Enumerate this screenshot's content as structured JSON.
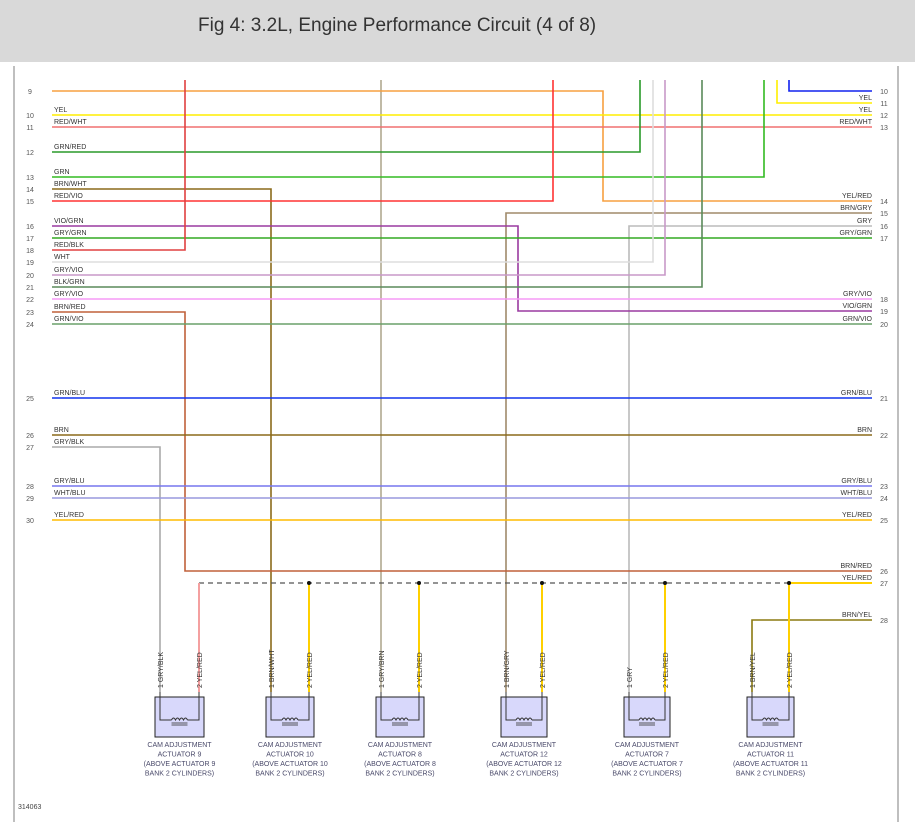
{
  "header": {
    "title": "Fig 4: 3.2L, Engine Performance Circuit (4 of 8)"
  },
  "figure_id": "314063",
  "left_rows": [
    {
      "num": "9",
      "label": "",
      "color": "#f7a040"
    },
    {
      "num": "10",
      "label": "YEL",
      "color": "#ffee00"
    },
    {
      "num": "11",
      "label": "RED/WHT",
      "color": "#f07070"
    },
    {
      "num": "12",
      "label": "GRN/RED",
      "color": "#2a9a2a"
    },
    {
      "num": "13",
      "label": "GRN",
      "color": "#33bb22"
    },
    {
      "num": "14",
      "label": "BRN/WHT",
      "color": "#8b6a1a"
    },
    {
      "num": "15",
      "label": "RED/VIO",
      "color": "#ff3333"
    },
    {
      "num": "16",
      "label": "VIO/GRN",
      "color": "#9a3aa0"
    },
    {
      "num": "17",
      "label": "GRY/GRN",
      "color": "#33aa22"
    },
    {
      "num": "18",
      "label": "RED/BLK",
      "color": "#e04040"
    },
    {
      "num": "19",
      "label": "WHT",
      "color": "#dddddd"
    },
    {
      "num": "20",
      "label": "GRY/VIO",
      "color": "#c899c8"
    },
    {
      "num": "21",
      "label": "BLK/GRN",
      "color": "#5a8a5a"
    },
    {
      "num": "22",
      "label": "GRY/VIO",
      "color": "#f59af5"
    },
    {
      "num": "23",
      "label": "BRN/RED",
      "color": "#c0603a"
    },
    {
      "num": "24",
      "label": "GRN/VIO",
      "color": "#6aa06a"
    },
    {
      "num": "25",
      "label": "GRN/BLU",
      "color": "#1133ee"
    },
    {
      "num": "26",
      "label": "BRN",
      "color": "#8b6a1a"
    },
    {
      "num": "27",
      "label": "GRY/BLK",
      "color": "#aaaaaa"
    },
    {
      "num": "28",
      "label": "GRY/BLU",
      "color": "#7777ee"
    },
    {
      "num": "29",
      "label": "WHT/BLU",
      "color": "#9999dd"
    },
    {
      "num": "30",
      "label": "YEL/RED",
      "color": "#ffbb00"
    }
  ],
  "right_rows": [
    {
      "num": "10",
      "label": ""
    },
    {
      "num": "11",
      "label": "YEL"
    },
    {
      "num": "12",
      "label": "YEL"
    },
    {
      "num": "13",
      "label": "RED/WHT"
    },
    {
      "num": "14",
      "label": "YEL/RED"
    },
    {
      "num": "15",
      "label": "BRN/GRY"
    },
    {
      "num": "16",
      "label": "GRY"
    },
    {
      "num": "17",
      "label": "GRY/GRN"
    },
    {
      "num": "18",
      "label": "GRY/VIO"
    },
    {
      "num": "19",
      "label": "VIO/GRN"
    },
    {
      "num": "20",
      "label": "GRN/VIO"
    },
    {
      "num": "21",
      "label": "GRN/BLU"
    },
    {
      "num": "22",
      "label": "BRN"
    },
    {
      "num": "23",
      "label": "GRY/BLU"
    },
    {
      "num": "24",
      "label": "WHT/BLU"
    },
    {
      "num": "25",
      "label": "YEL/RED"
    },
    {
      "num": "26",
      "label": "BRN/RED"
    },
    {
      "num": "27",
      "label": "YEL/RED"
    },
    {
      "num": "28",
      "label": "BRN/YEL"
    }
  ],
  "right_wire_colors": {
    "blu": "#1122ee",
    "yel": "#ffee00",
    "brn_gry": "#a08a6a",
    "gry": "#bbbbbb",
    "yel_red": "#ffd000",
    "brn_yel": "#8b7a10",
    "gry_brn": "#b0a890",
    "brn_red": "#c07a3a"
  },
  "actuators": [
    {
      "lines": [
        "CAM ADJUSTMENT",
        "ACTUATOR 9",
        "(ABOVE ACTUATOR 9",
        "BANK 2 CYLINDERS)"
      ],
      "pin1": "1  GRY/BLK",
      "pin2": "2  YEL/RED"
    },
    {
      "lines": [
        "CAM ADJUSTMENT",
        "ACTUATOR 10",
        "(ABOVE ACTUATOR 10",
        "BANK 2 CYLINDERS)"
      ],
      "pin1": "1  BRN/WHT",
      "pin2": "2  YEL/RED"
    },
    {
      "lines": [
        "CAM ADJUSTMENT",
        "ACTUATOR 8",
        "(ABOVE ACTUATOR 8",
        "BANK 2 CYLINDERS)"
      ],
      "pin1": "1  GRY/BRN",
      "pin2": "2  YEL/RED"
    },
    {
      "lines": [
        "CAM ADJUSTMENT",
        "ACTUATOR 12",
        "(ABOVE ACTUATOR 12",
        "BANK 2 CYLINDERS)"
      ],
      "pin1": "1  BRN/GRY",
      "pin2": "2  YEL/RED"
    },
    {
      "lines": [
        "CAM ADJUSTMENT",
        "ACTUATOR 7",
        "(ABOVE ACTUATOR 7",
        "BANK 2 CYLINDERS)"
      ],
      "pin1": "1  GRY",
      "pin2": "2  YEL/RED"
    },
    {
      "lines": [
        "CAM ADJUSTMENT",
        "ACTUATOR 11",
        "(ABOVE ACTUATOR 11",
        "BANK 2 CYLINDERS)"
      ],
      "pin1": "1  BRN/YEL",
      "pin2": "2  YEL/RED"
    }
  ]
}
